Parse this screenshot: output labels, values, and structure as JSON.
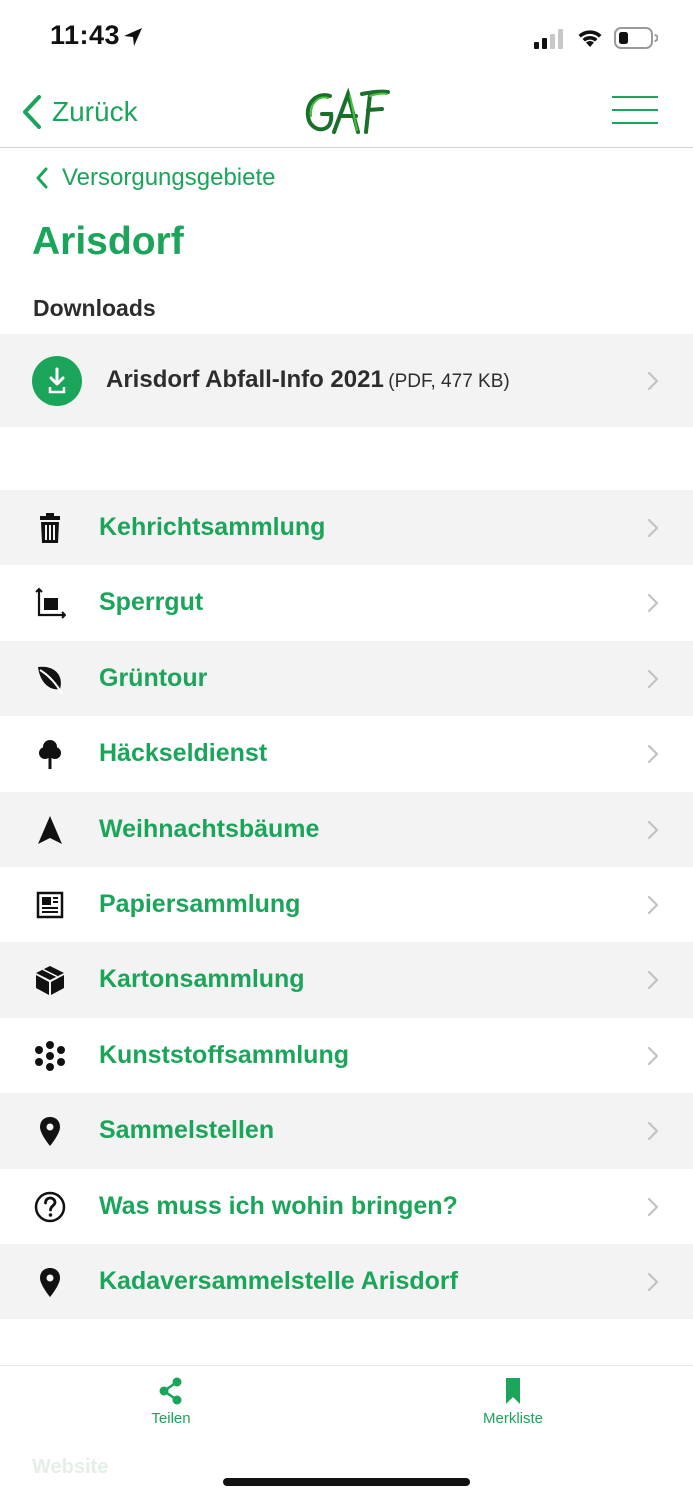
{
  "status_bar": {
    "time": "11:43",
    "location_icon": "location-arrow-icon",
    "signal_icon": "cellular-signal-icon",
    "wifi_icon": "wifi-icon",
    "battery_icon": "battery-low-icon"
  },
  "nav": {
    "back_label": "Zurück",
    "logo_text": "GAF",
    "menu_icon": "hamburger-menu-icon"
  },
  "breadcrumb": {
    "label": "Versorgungsgebiete"
  },
  "page": {
    "title": "Arisdorf",
    "downloads_heading": "Downloads"
  },
  "downloads": [
    {
      "title": "Arisdorf Abfall-Info 2021",
      "meta": "(PDF, 477 KB)",
      "icon": "download-icon"
    }
  ],
  "services": [
    {
      "label": "Kehrichtsammlung",
      "icon": "trash-can-icon"
    },
    {
      "label": "Sperrgut",
      "icon": "bulky-item-dimensions-icon"
    },
    {
      "label": "Grüntour",
      "icon": "leaf-icon"
    },
    {
      "label": "Häckseldienst",
      "icon": "tree-icon"
    },
    {
      "label": "Weihnachtsbäume",
      "icon": "christmas-tree-icon"
    },
    {
      "label": "Papiersammlung",
      "icon": "newspaper-icon"
    },
    {
      "label": "Kartonsammlung",
      "icon": "box-icon"
    },
    {
      "label": "Kunststoffsammlung",
      "icon": "plastic-molecule-icon"
    },
    {
      "label": "Sammelstellen",
      "icon": "map-pin-icon"
    },
    {
      "label": "Was muss ich wohin bringen?",
      "icon": "question-circle-icon"
    },
    {
      "label": "Kadaversammelstelle Arisdorf",
      "icon": "map-pin-icon"
    }
  ],
  "tab_bar": {
    "share_label": "Teilen",
    "bookmarks_label": "Merkliste",
    "website_label": "Website"
  },
  "colors": {
    "accent": "#1ba55a",
    "row_alt": "#f3f3f3",
    "text": "#2d2d2d"
  }
}
